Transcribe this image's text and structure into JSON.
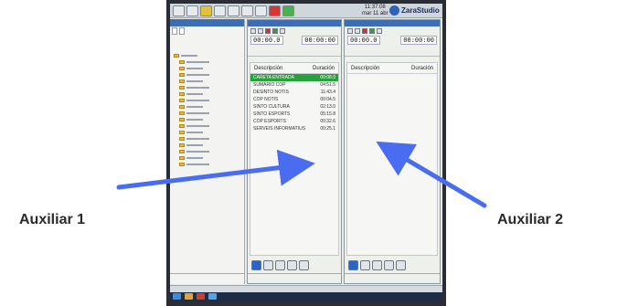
{
  "app": {
    "brand": "ZaraStudio",
    "clock_time": "11:37:08",
    "clock_date": "mar 11 abr"
  },
  "panels": [
    {
      "columns": {
        "description": "Descripción",
        "duration": "Duración"
      },
      "counter_left": "00:00.0",
      "counter_right": "00:00:00",
      "rows": [
        {
          "description": "CARETA ENTRADA",
          "duration": "00:08.0",
          "selected": true
        },
        {
          "description": "SUMARIO COP",
          "duration": "04:51.5"
        },
        {
          "description": "DESINTO NOTIS",
          "duration": "11:43.4"
        },
        {
          "description": "COP NOTIS",
          "duration": "00:04.5"
        },
        {
          "description": "SINTO CULTURA",
          "duration": "02:13.0"
        },
        {
          "description": "SINTO ESPORTS",
          "duration": "05:15.8"
        },
        {
          "description": "COP ESPORTS",
          "duration": "00:32.6"
        },
        {
          "description": "SERVEIS INFORMATIUS",
          "duration": "00:25.1"
        }
      ]
    },
    {
      "columns": {
        "description": "Descripción",
        "duration": "Duración"
      },
      "counter_left": "00:00.0",
      "counter_right": "00:00:00",
      "rows": []
    }
  ],
  "annotations": {
    "left": "Auxiliar 1",
    "right": "Auxiliar 2"
  },
  "colors": {
    "arrow": "#4a6cf0",
    "selected_row": "#27a23a",
    "title_bar": "#3e6db5"
  }
}
